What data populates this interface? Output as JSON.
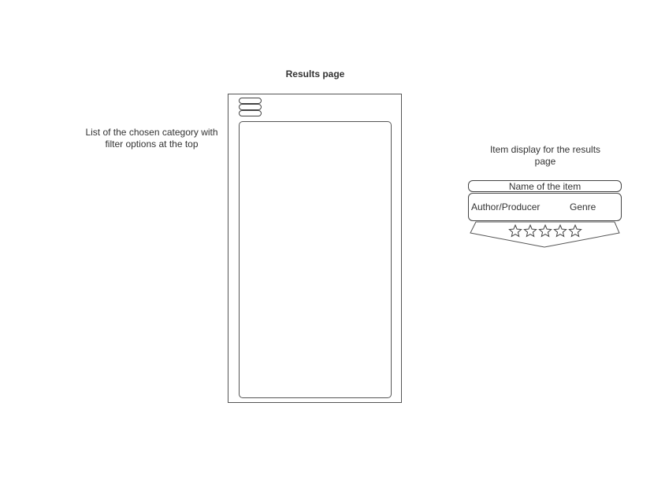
{
  "title": "Results page",
  "left_note": "List of the chosen category with filter options at the top",
  "right_note": "Item display for the results page",
  "item_card": {
    "name": "Name of the item",
    "author": "Author/Producer",
    "genre": "Genre",
    "stars_total": 5
  },
  "colors": {
    "stroke": "#555555",
    "text": "#333333",
    "background": "#ffffff"
  },
  "icons": [
    "menu-icon",
    "star-icon"
  ]
}
